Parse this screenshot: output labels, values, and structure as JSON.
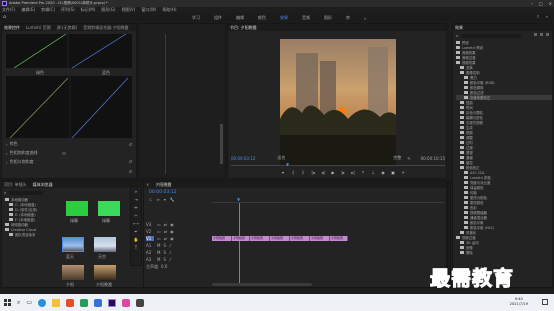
{
  "app": {
    "title": "Adobe Premiere Pro 2020 - D:\\视频\\0001\\单镜头.prproj *",
    "menus": [
      "文件(F)",
      "编辑(E)",
      "剪辑(C)",
      "序列(S)",
      "标记(M)",
      "图形(G)",
      "视图(V)",
      "窗口(W)",
      "帮助(H)"
    ],
    "workspaces": [
      "学习",
      "组件",
      "编辑",
      "颜色",
      "效果",
      "音频",
      "图形",
      "库"
    ],
    "active_workspace": "效果"
  },
  "left_top": {
    "tabs": [
      "效果控件",
      "Lumetri 范围",
      "源:(无剪辑)",
      "音频剪辑混合器:夕阳晚霞"
    ],
    "curve_labels": [
      "绿色",
      "蓝色"
    ],
    "section_labels": [
      "棕色",
      "色相饱和度曲线",
      "色相与饱和度"
    ]
  },
  "program": {
    "title": "节目: 夕阳晚霞",
    "timecode_left": "00:00:03:12",
    "fit": "适合",
    "quality": "完整",
    "timecode_right": "00:00:10:15"
  },
  "project": {
    "tabs": [
      "项目: 单镜头",
      "媒体浏览器"
    ],
    "search_placeholder": "",
    "tree": [
      "本地驱动器",
      "C: (本地磁盘)",
      "D: (软件/应用)",
      "E: (本地磁盘)",
      "F: (本地磁盘)",
      "网络驱动器",
      "Creative Cloud",
      "团队项目版本"
    ],
    "thumb_labels": [
      "绿幕",
      "绿幕",
      "蓝天",
      "天空",
      "夕阳",
      "夕阳晚霞"
    ]
  },
  "timeline": {
    "tab": "夕阳晚霞",
    "timecode": "00:00:03:12",
    "tracks": [
      "V3",
      "V2",
      "V1",
      "A1",
      "A2",
      "A3"
    ],
    "clips": [
      "夕阳晚霞",
      "夕阳晚霞",
      "夕阳晚霞",
      "夕阳晚霞",
      "夕阳晚霞",
      "夕阳晚霞",
      "夕阳晚霞"
    ],
    "master": "主声道",
    "master_value": "0.0"
  },
  "effects": {
    "title": "效果",
    "items": [
      "预设",
      "Lumetri 预设",
      "音频效果",
      "音频过渡",
      "视频效果",
      "变换",
      "图像控制",
      "黑白",
      "颜色平衡 (RGB)",
      "颜色替换",
      "颜色过滤",
      "灰度系数校正",
      "扭曲",
      "时间",
      "杂色与颗粒",
      "模糊与锐化",
      "沉浸式视频",
      "生成",
      "视频",
      "调整",
      "过时",
      "过渡",
      "透视",
      "通道",
      "键控",
      "颜色校正",
      "ASC CDL",
      "Lumetri 颜色",
      "亮度与对比度",
      "保留颜色",
      "均衡",
      "更改为颜色",
      "更改颜色",
      "色彩",
      "视频限幅器",
      "通道混合器",
      "颜色平衡",
      "颜色平衡 (HLS)",
      "风格化",
      "视频过渡",
      "3D 运动",
      "划像",
      "擦除"
    ]
  },
  "watermark": "最需教育",
  "taskbar": {
    "time": "9:40",
    "date": "2021/7/19"
  },
  "colors": {
    "accent": "#4a8cf0",
    "clip": "#c48ad0",
    "bg": "#232323"
  }
}
